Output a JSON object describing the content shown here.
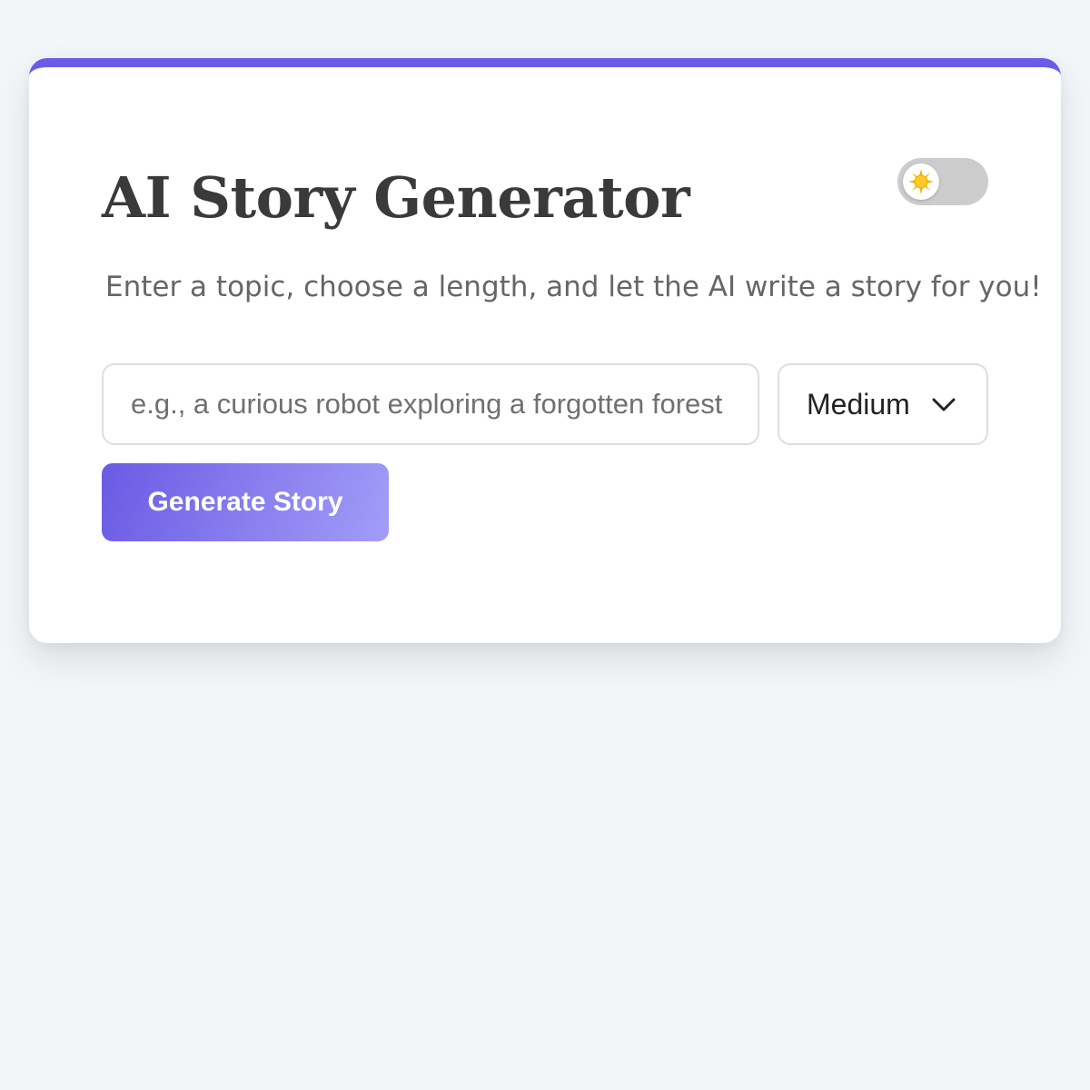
{
  "header": {
    "title": "AI Story Generator",
    "subtitle": "Enter a topic, choose a length, and let the AI write a story for you!"
  },
  "theme_toggle": {
    "icon": "sun-icon",
    "state": "light"
  },
  "form": {
    "topic": {
      "value": "",
      "placeholder": "e.g., a curious robot exploring a forgotten forest"
    },
    "length": {
      "selected": "Medium",
      "icon": "chevron-down-icon"
    },
    "generate_label": "Generate Story"
  },
  "colors": {
    "accent": "#6b5ce7",
    "background": "#f3f6f8",
    "card": "#ffffff",
    "toggle_track": "#cccccc"
  }
}
